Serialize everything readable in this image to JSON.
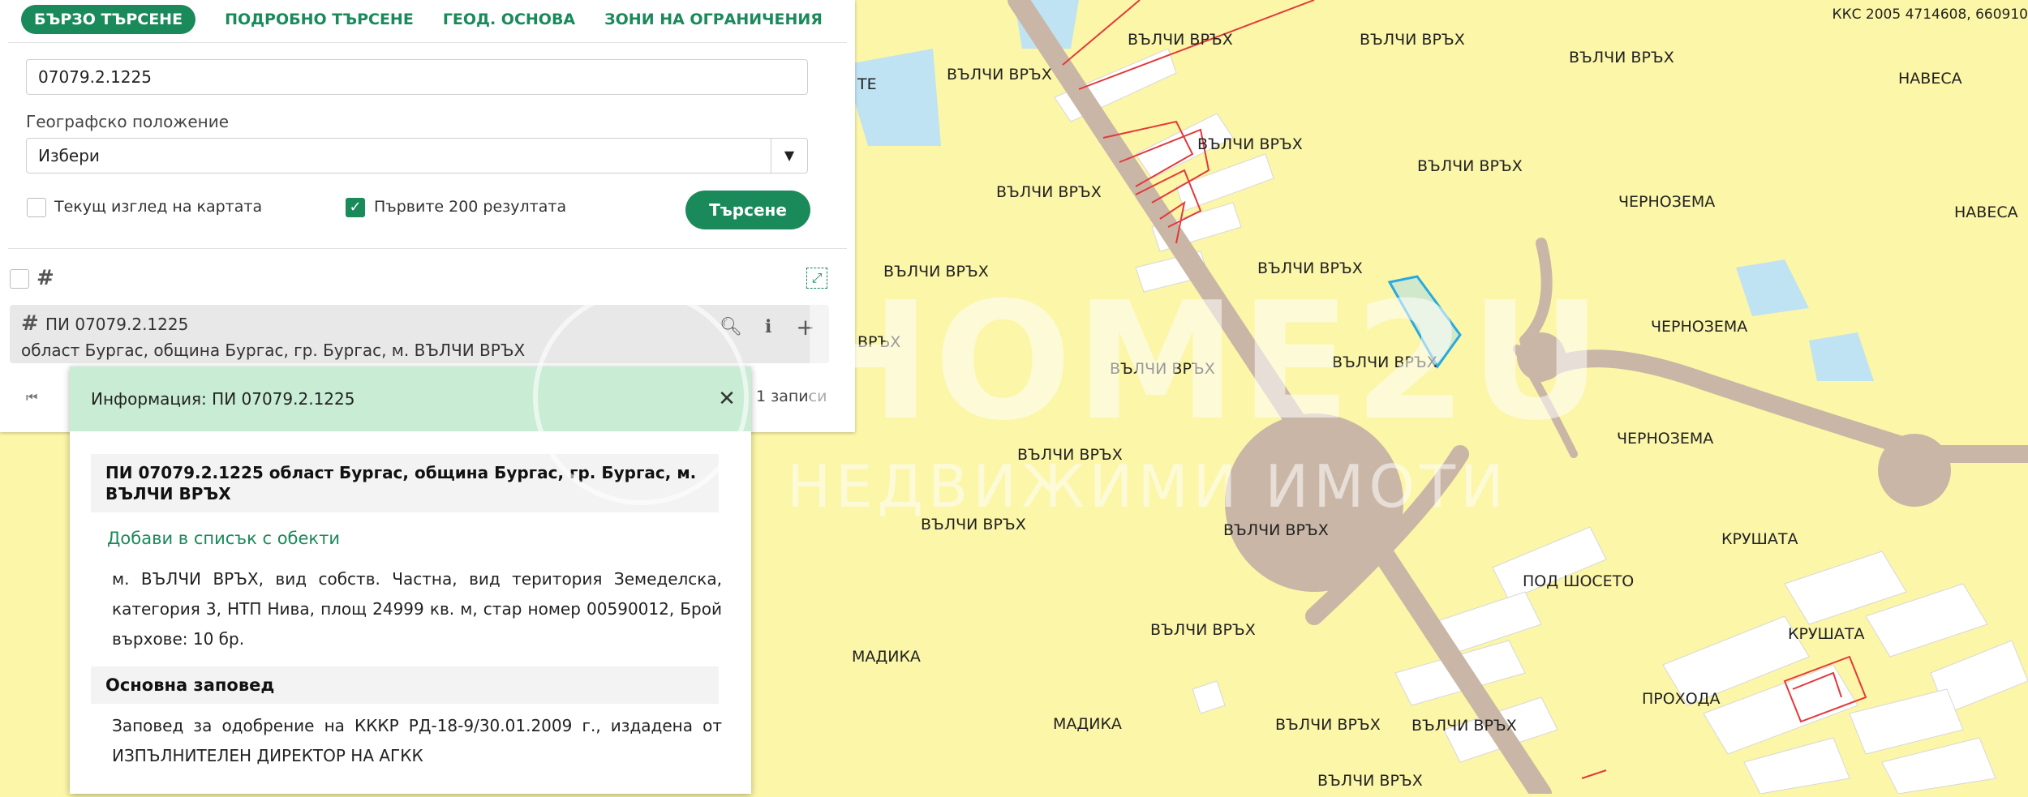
{
  "map": {
    "coords_label": "ККС 2005 4714608, 660910",
    "labels": [
      {
        "text": "ВЪЛЧИ ВРЪХ"
      },
      {
        "text": "ВЪЛЧИ ВРЪХ"
      },
      {
        "text": "ВЪЛЧИ ВРЪХ"
      },
      {
        "text": "НАВЕСА"
      },
      {
        "text": "ВЪЛЧИ ВРЪХ"
      },
      {
        "text": "ВЪЛЧИ ВРЪХ"
      },
      {
        "text": "ВЪЛЧИ ВРЪХ"
      },
      {
        "text": "ЧЕРНОЗЕМА"
      },
      {
        "text": "НАВЕСА"
      },
      {
        "text": "ВЪЛЧИ ВРЪХ"
      },
      {
        "text": "ВЪЛЧИ ВРЪХ"
      },
      {
        "text": "ЧЕРНОЗЕМА"
      },
      {
        "text": "ВЪЛЧИ ВРЪХ"
      },
      {
        "text": "ВЪЛЧИ ВРЪХ"
      },
      {
        "text": "ВЪЛЧИ ВРЪХ"
      },
      {
        "text": "ЧЕРНОЗЕМА"
      },
      {
        "text": "ВЪЛЧИ ВРЪХ"
      },
      {
        "text": "ВЪЛЧИ ВРЪХ"
      },
      {
        "text": "КРУШАТА"
      },
      {
        "text": "ПОД ШОСЕТО"
      },
      {
        "text": "ВЪЛЧИ ВРЪХ"
      },
      {
        "text": "ВЪЛЧИ ВРЪХ"
      },
      {
        "text": "КРУШАТА"
      },
      {
        "text": "МАДИКА"
      },
      {
        "text": "ПРОХОДА"
      },
      {
        "text": "МАДИКА"
      },
      {
        "text": "ВЪЛЧИ ВРЪХ"
      },
      {
        "text": "ВЪЛЧИ ВРЪХ"
      },
      {
        "text": "ВЪЛЧИ ВРЪХ"
      },
      {
        "text": "ТЕ"
      },
      {
        "text": "ВРЪХ"
      }
    ]
  },
  "watermark": {
    "brand": "HOME2U",
    "tagline": "НЕДВИЖИМИ ИМОТИ"
  },
  "search": {
    "tabs": [
      "БЪРЗО ТЪРСЕНЕ",
      "ПОДРОБНО ТЪРСЕНЕ",
      "ГЕОД. ОСНОВА",
      "ЗОНИ НА ОГРАНИЧЕНИЯ"
    ],
    "query": "07079.2.1225",
    "geo_label": "Географско положение",
    "geo_value": "Избери",
    "current_view_label": "Текущ изглед на картата",
    "first200_label": "Първите 200 резултата",
    "first200_checked": true,
    "search_button": "Търсене"
  },
  "result": {
    "title": "ПИ 07079.2.1225",
    "subtitle": "област Бургас, община Бургас, гр. Бургас, м. ВЪЛЧИ ВРЪХ",
    "records_label": "1 записи"
  },
  "info": {
    "header": "Информация: ПИ 07079.2.1225",
    "box_title": "ПИ 07079.2.1225 област Бургас, община Бургас, гр. Бургас, м. ВЪЛЧИ ВРЪХ",
    "add_link": "Добави в списък с обекти",
    "details": "м. ВЪЛЧИ ВРЪХ, вид собств. Частна, вид територия Земеделска, категория 3, НТП Нива, площ 24999 кв. м, стар номер 00590012, Брой върхове: 10 бр.",
    "order_heading": "Основна заповед",
    "order_text": "Заповед за одобрение на КККР РД-18-9/30.01.2009 г., издадена от ИЗПЪЛНИТЕЛЕН ДИРЕКТОР НА АГКК"
  },
  "colors": {
    "accent": "#1a8a5a",
    "map_bg": "#fcf6a8",
    "road": "#c9b6a6",
    "parcel_highlight": "#29a9e0"
  },
  "icons": [
    "grid-icon",
    "search-icon",
    "info-icon",
    "plus-icon",
    "close-icon",
    "first-page-icon",
    "chevron-down-icon",
    "fullscreen-icon"
  ]
}
